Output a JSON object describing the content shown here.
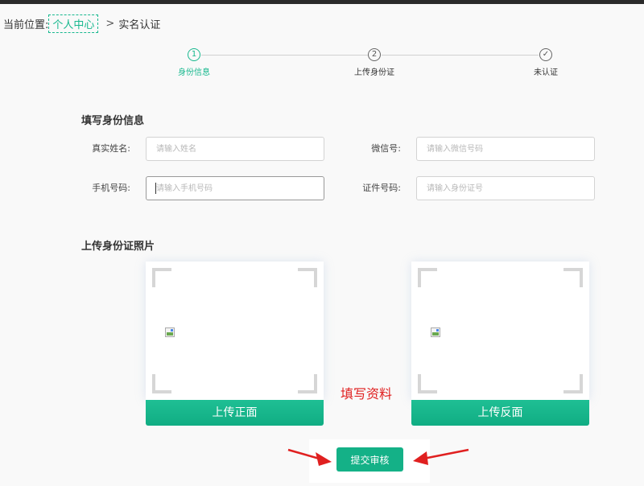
{
  "breadcrumb": {
    "prefix": "当前位置:",
    "link": "个人中心",
    "separator": ">",
    "current": "实名认证"
  },
  "steps": [
    {
      "number": "1",
      "label": "身份信息",
      "state": "active"
    },
    {
      "number": "2",
      "label": "上传身份证",
      "state": "pending"
    },
    {
      "number": "✓",
      "label": "未认证",
      "state": "pending"
    }
  ],
  "identity_section": {
    "title": "填写身份信息",
    "fields": {
      "name": {
        "label": "真实姓名:",
        "value": "",
        "placeholder": "请输入姓名"
      },
      "wechat": {
        "label": "微信号:",
        "value": "",
        "placeholder": "请输入微信号码"
      },
      "phone": {
        "label": "手机号码:",
        "value": "",
        "placeholder": "请输入手机号码"
      },
      "id_number": {
        "label": "证件号码:",
        "value": "",
        "placeholder": "请输入身份证号"
      }
    }
  },
  "upload_section": {
    "title": "上传身份证照片",
    "front_button": "上传正面",
    "back_button": "上传反面"
  },
  "annotation": {
    "text": "填写资料",
    "color": "#e02020"
  },
  "submit": {
    "label": "提交审核"
  },
  "colors": {
    "accent": "#17b88e",
    "annotation": "#e02020",
    "topbar": "#2b2b2b"
  }
}
